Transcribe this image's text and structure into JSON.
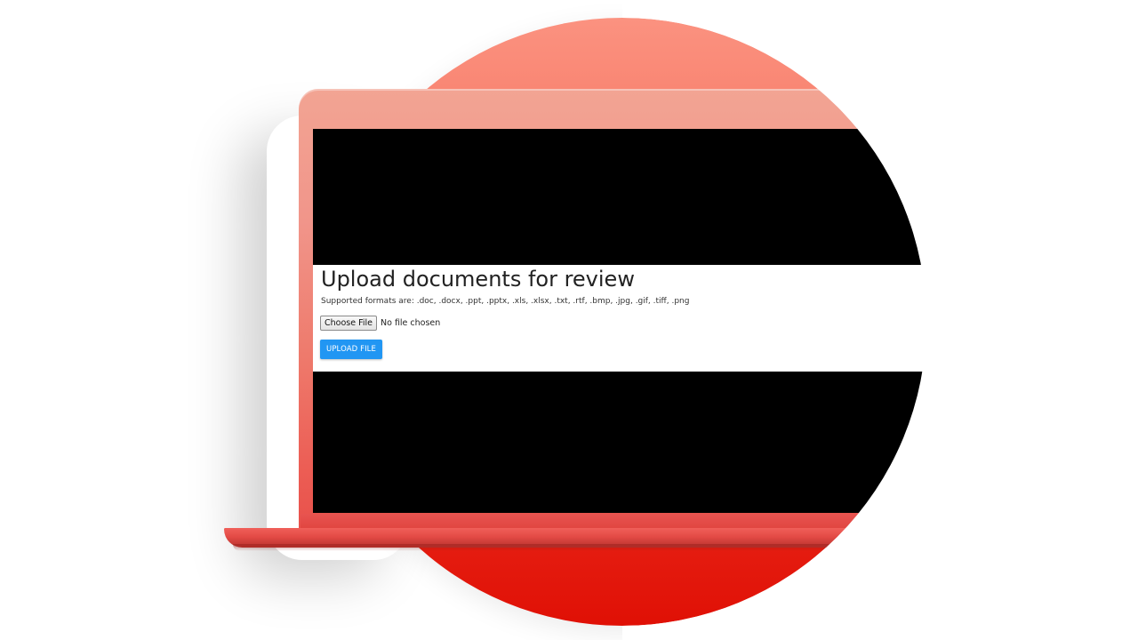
{
  "page": {
    "title": "Upload documents for review",
    "supported_formats": "Supported formats are: .doc, .docx, .ppt, .pptx, .xls, .xlsx, .txt, .rtf, .bmp, .jpg, .gif, .tiff, .png"
  },
  "file_input": {
    "button_label": "Choose File",
    "status": "No file chosen"
  },
  "upload_button": {
    "label": "UPLOAD FILE"
  },
  "colors": {
    "upload_button": "#2196f3",
    "laptop": "#ee6d60",
    "circle_top": "#fb9280",
    "circle_bottom": "#e01005"
  }
}
